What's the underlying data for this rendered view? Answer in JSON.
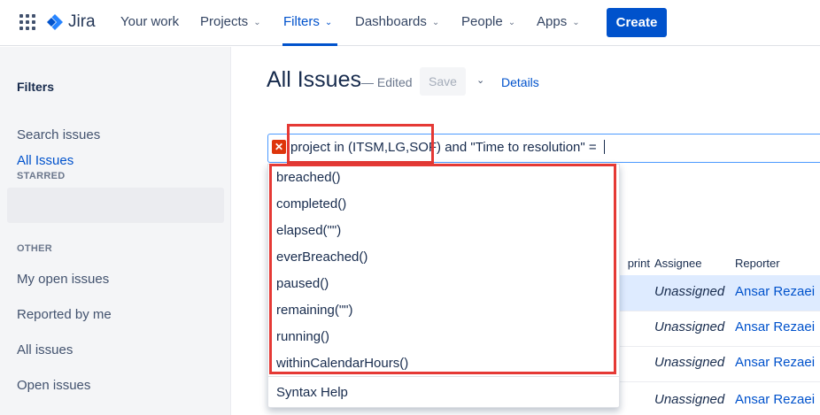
{
  "topnav": {
    "logo_text": "Jira",
    "items": [
      {
        "label": "Your work"
      },
      {
        "label": "Projects"
      },
      {
        "label": "Filters"
      },
      {
        "label": "Dashboards"
      },
      {
        "label": "People"
      },
      {
        "label": "Apps"
      }
    ],
    "create_label": "Create",
    "brand_color": "#0052CC"
  },
  "sidebar": {
    "title": "Filters",
    "search_label": "Search issues",
    "starred_heading": "STARRED",
    "starred_items": [
      "All Issues"
    ],
    "other_heading": "OTHER",
    "other_items": [
      "My open issues",
      "Reported by me",
      "All issues",
      "Open issues"
    ]
  },
  "main": {
    "title": "All Issues",
    "edited_label": "— Edited",
    "save_label": "Save",
    "details_label": "Details",
    "query_highlighted": "project in (ITSM,LG,SOF)",
    "query_rest": " and \"Time to resolution\" = ",
    "error_icon_symbol": "✕"
  },
  "suggestions": {
    "items": [
      "breached()",
      "completed()",
      "elapsed(\"\")",
      "everBreached()",
      "paused()",
      "remaining(\"\")",
      "running()",
      "withinCalendarHours()"
    ],
    "syntax_help": "Syntax Help"
  },
  "table": {
    "headers": [
      "print",
      "Assignee",
      "Reporter"
    ],
    "rows": [
      {
        "assignee": "Unassigned",
        "reporter": "Ansar Rezaei"
      },
      {
        "assignee": "Unassigned",
        "reporter": "Ansar Rezaei"
      },
      {
        "assignee": "Unassigned",
        "reporter": "Ansar Rezaei"
      },
      {
        "assignee": "Unassigned",
        "reporter": "Ansar Rezaei"
      }
    ]
  },
  "annotation_color": "#E53935"
}
